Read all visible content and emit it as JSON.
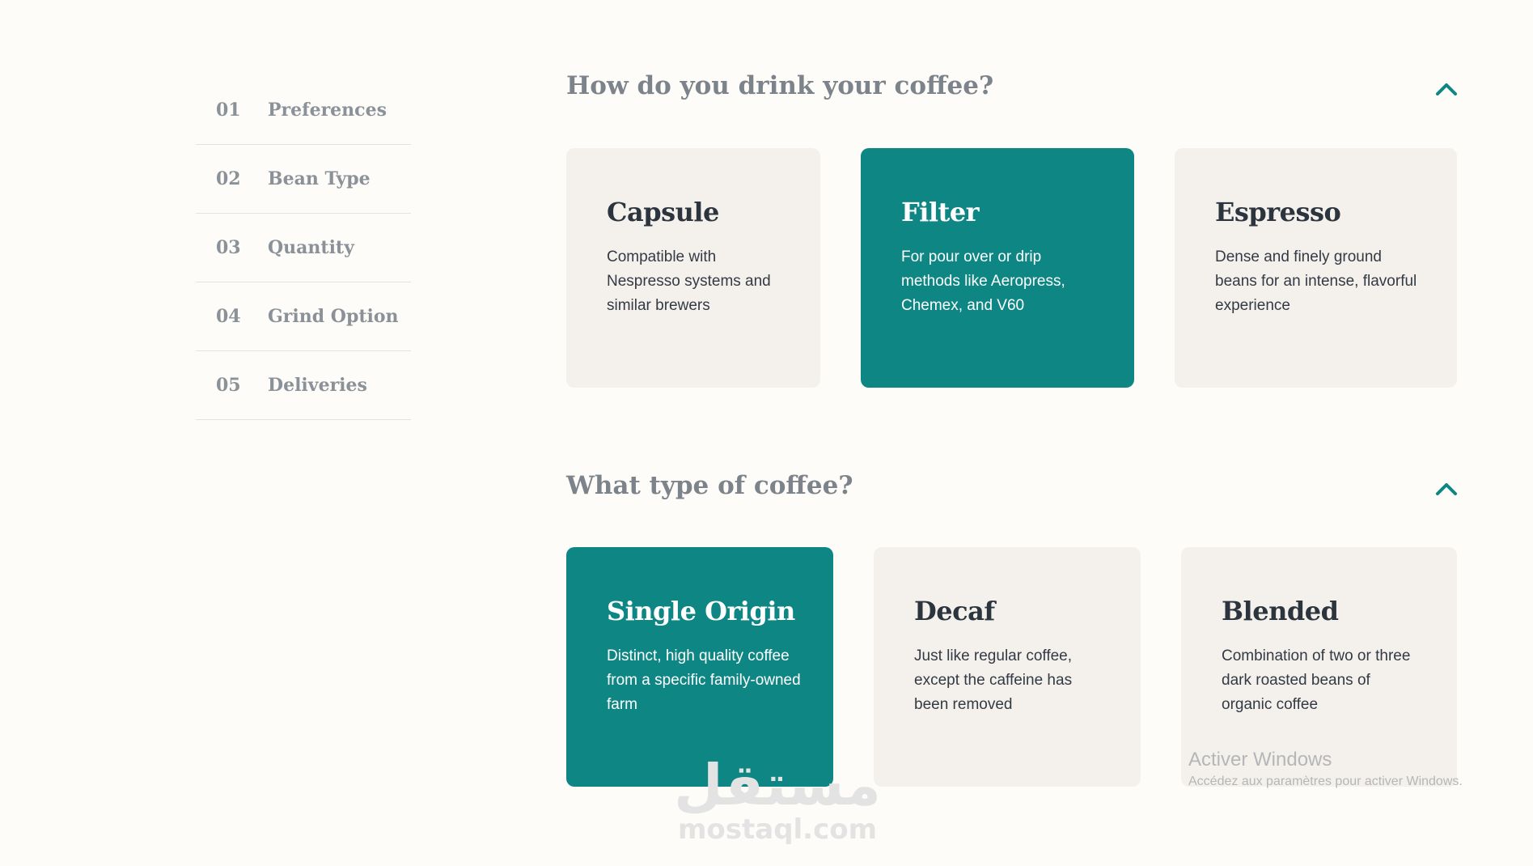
{
  "sidebar": {
    "items": [
      {
        "num": "01",
        "label": "Preferences"
      },
      {
        "num": "02",
        "label": "Bean Type"
      },
      {
        "num": "03",
        "label": "Quantity"
      },
      {
        "num": "04",
        "label": "Grind Option"
      },
      {
        "num": "05",
        "label": "Deliveries"
      }
    ]
  },
  "sections": [
    {
      "title": "How do you drink your coffee?",
      "options": [
        {
          "title": "Capsule",
          "description": "Compatible with Nespresso systems and similar brewers",
          "selected": false
        },
        {
          "title": "Filter",
          "description": "For pour over or drip methods like Aeropress, Chemex, and V60",
          "selected": true
        },
        {
          "title": "Espresso",
          "description": "Dense and finely ground beans for an intense, flavorful experience",
          "selected": false
        }
      ]
    },
    {
      "title": "What type of coffee?",
      "options": [
        {
          "title": "Single Origin",
          "description": "Distinct, high quality coffee from a specific family-owned farm",
          "selected": true
        },
        {
          "title": "Decaf",
          "description": "Just like regular coffee, except the caffeine has been removed",
          "selected": false
        },
        {
          "title": "Blended",
          "description": "Combination of two or three dark roasted beans of organic coffee",
          "selected": false
        }
      ]
    }
  ],
  "icons": {
    "collapse": "chevron-up-icon"
  },
  "colors": {
    "accent": "#0e8784",
    "background": "#fefcf8",
    "card": "#f4f1ed",
    "heading": "#2c343e",
    "muted": "#8a9198"
  },
  "watermarks": {
    "windows_title": "Activer Windows",
    "windows_subtitle": "Accédez aux paramètres pour activer Windows.",
    "mostaql_arabic": "مستقل",
    "mostaql_latin": "mostaql.com"
  }
}
